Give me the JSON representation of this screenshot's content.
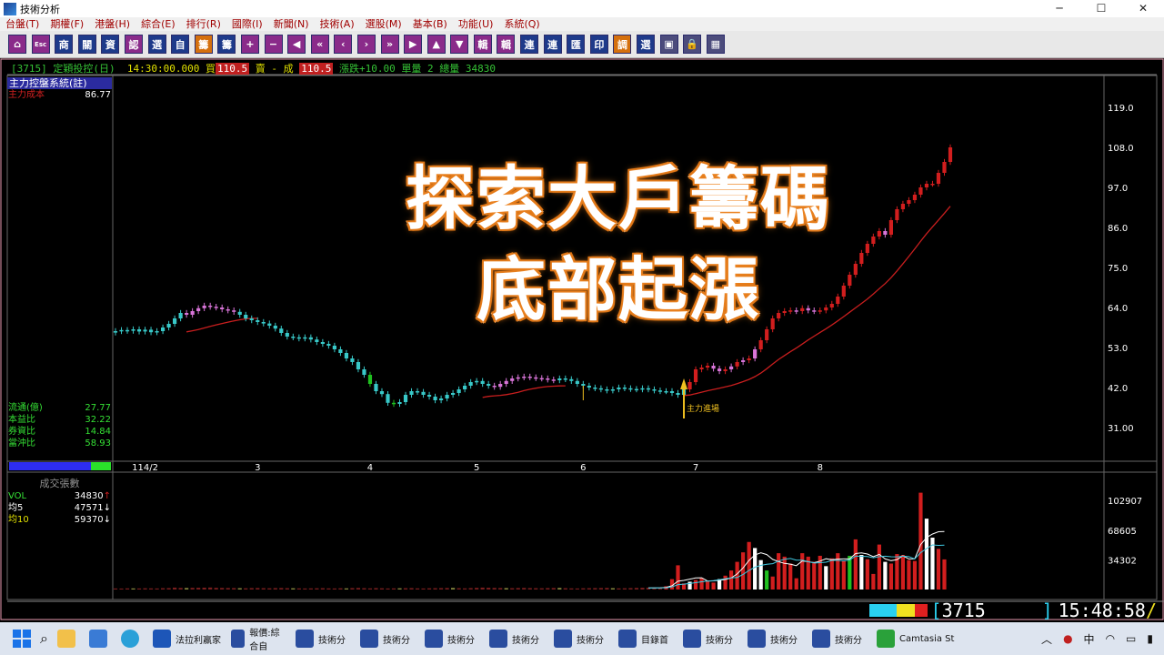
{
  "window": {
    "title": "技術分析",
    "controls": [
      "─",
      "☐",
      "✕"
    ]
  },
  "menu": [
    "台盤(T)",
    "期權(F)",
    "港盤(H)",
    "綜合(E)",
    "排行(R)",
    "國際(I)",
    "新聞(N)",
    "技術(A)",
    "選股(M)",
    "基本(B)",
    "功能(U)",
    "系統(Q)"
  ],
  "toolbar": [
    "⌂",
    "Esc",
    "商",
    "關",
    "資",
    "認",
    "選",
    "自",
    "籌",
    "籌",
    "+",
    "−",
    "◀",
    "«",
    "‹",
    "›",
    "»",
    "▶",
    "▲",
    "▼",
    "輯",
    "輯",
    "連",
    "連",
    "匯",
    "印",
    "調",
    "選",
    "▣",
    "🔒",
    "▦"
  ],
  "status": {
    "code": "[3715]",
    "name": "定穎投控(日)",
    "time": "14:30:00.000",
    "buy_label": "買",
    "buy": "110.5",
    "sell_label": "賣 - 成",
    "deal": "110.5",
    "change_label": "漲跌",
    "change": "+10.00",
    "unit_label": "單量",
    "unit": "2",
    "total_label": "總量",
    "total": "34830"
  },
  "left": {
    "system_name": "主力控盤系統(註)",
    "cost_label": "主力成本",
    "cost_value": "86.77",
    "stats": [
      {
        "label": "流通(億)",
        "value": "27.77"
      },
      {
        "label": "本益比",
        "value": "32.22"
      },
      {
        "label": "券資比",
        "value": "14.84"
      },
      {
        "label": "當沖比",
        "value": "58.93"
      }
    ]
  },
  "volume": {
    "title": "成交張數",
    "rows": [
      {
        "label": "VOL",
        "value": "34830",
        "arrow": "↑"
      },
      {
        "label": "均5",
        "value": "47571",
        "arrow": "↓"
      },
      {
        "label": "均10",
        "value": "59370",
        "arrow": "↓"
      }
    ]
  },
  "overlay": {
    "line1": "探索大戶籌碼",
    "line2": "底部起漲"
  },
  "annotation": "主力進場",
  "ticker": {
    "code": "3715",
    "time": "15:48:58"
  },
  "taskbar": [
    {
      "label": "法拉利嬴家",
      "color": "#1d56b8"
    },
    {
      "label": "報價:綜合自",
      "color": "#2a4d9f"
    },
    {
      "label": "技術分",
      "color": "#2a4d9f"
    },
    {
      "label": "技術分",
      "color": "#2a4d9f"
    },
    {
      "label": "技術分",
      "color": "#2a4d9f"
    },
    {
      "label": "技術分",
      "color": "#2a4d9f"
    },
    {
      "label": "技術分",
      "color": "#2a4d9f"
    },
    {
      "label": "目錄首",
      "color": "#2a4d9f"
    },
    {
      "label": "技術分",
      "color": "#2a4d9f"
    },
    {
      "label": "技術分",
      "color": "#2a4d9f"
    },
    {
      "label": "技術分",
      "color": "#2a4d9f"
    },
    {
      "label": "Camtasia St",
      "color": "#2aa13a"
    }
  ],
  "tray": {
    "ime": "中"
  },
  "chart_data": {
    "type": "candlestick",
    "y_ticks": [
      "119.0",
      "108.0",
      "97.0",
      "86.0",
      "75.0",
      "64.0",
      "53.0",
      "42.0",
      "31.00"
    ],
    "ylim": [
      20,
      130
    ],
    "x_ticks": [
      {
        "label": "114/2",
        "index": 5
      },
      {
        "label": "3",
        "index": 24
      },
      {
        "label": "4",
        "index": 43
      },
      {
        "label": "5",
        "index": 61
      },
      {
        "label": "6",
        "index": 79
      },
      {
        "label": "7",
        "index": 98
      },
      {
        "label": "8",
        "index": 119
      }
    ],
    "closes": [
      57.5,
      57.8,
      57.6,
      58.0,
      57.4,
      57.9,
      57.2,
      57.5,
      58.5,
      59.5,
      61.0,
      62.5,
      62.0,
      63.0,
      63.8,
      64.5,
      64.2,
      64.0,
      63.5,
      63.2,
      62.8,
      62.0,
      61.0,
      60.5,
      60.0,
      59.6,
      59.0,
      58.2,
      57.0,
      56.0,
      55.8,
      55.5,
      55.8,
      55.2,
      54.5,
      54.0,
      53.5,
      52.5,
      51.5,
      50.0,
      49.0,
      47.0,
      45.5,
      43.0,
      41.0,
      40.2,
      37.8,
      37.5,
      38.0,
      40.0,
      41.0,
      40.8,
      40.0,
      39.5,
      38.5,
      39.0,
      40.0,
      40.5,
      41.5,
      42.5,
      43.5,
      43.8,
      43.0,
      42.5,
      42.2,
      43.0,
      43.8,
      44.5,
      44.8,
      45.0,
      44.8,
      44.6,
      44.5,
      44.2,
      44.0,
      44.5,
      44.3,
      43.8,
      43.0,
      42.5,
      42.0,
      41.8,
      41.5,
      41.2,
      41.5,
      42.0,
      41.8,
      41.6,
      41.5,
      41.8,
      41.5,
      41.2,
      41.0,
      41.0,
      40.5,
      40.0,
      41.5,
      43.5,
      47.0,
      47.5,
      48.0,
      47.2,
      46.5,
      47.0,
      47.8,
      49.0,
      49.5,
      50.0,
      52.5,
      55.0,
      58.0,
      61.0,
      62.5,
      63.0,
      63.2,
      63.0,
      63.8,
      63.2,
      63.0,
      63.2,
      64.0,
      65.0,
      67.0,
      70.0,
      73.0,
      76.0,
      79.0,
      81.5,
      83.5,
      85.0,
      84.0,
      88.0,
      91.0,
      92.5,
      93.5,
      95.0,
      97.0,
      98.0,
      98.0,
      101.0,
      104.0,
      108.0
    ],
    "kline_colors": {
      "up": "#d21e1e",
      "down": "#38c8c8",
      "accum": "#d874d8",
      "signal": "#20c020"
    },
    "volumes": [
      1200,
      1100,
      1300,
      1250,
      1200,
      1400,
      1300,
      1200,
      1500,
      1600,
      2200,
      1800,
      1700,
      1900,
      2000,
      2100,
      2300,
      1900,
      1800,
      1700,
      1600,
      1500,
      1400,
      1600,
      1700,
      1500,
      1400,
      1600,
      1700,
      1500,
      1400,
      1300,
      1200,
      1300,
      1400,
      1500,
      1300,
      1200,
      1400,
      1300,
      1600,
      1800,
      1500,
      1300,
      1600,
      1400,
      1200,
      1300,
      1400,
      1500,
      1600,
      1300,
      1200,
      1400,
      1500,
      1600,
      1700,
      1800,
      1500,
      1300,
      1600,
      1900,
      2200,
      2000,
      1800,
      1700,
      1600,
      1500,
      1700,
      1800,
      1600,
      1500,
      1400,
      1600,
      1700,
      1800,
      1500,
      1300,
      1200,
      1400,
      1500,
      1600,
      1700,
      1800,
      1500,
      1300,
      1400,
      1600,
      1800,
      2000,
      2200,
      2100,
      1900,
      3800,
      12000,
      28000,
      7000,
      9000,
      11000,
      13000,
      9000,
      8000,
      12000,
      16000,
      22000,
      32000,
      43000,
      55000,
      48000,
      34000,
      22000,
      15000,
      42000,
      38000,
      30000,
      13000,
      42000,
      38000,
      32000,
      39000,
      27000,
      36000,
      42000,
      33000,
      39000,
      58000,
      40000,
      35000,
      18000,
      52000,
      32000,
      30000,
      41000,
      40000,
      34000,
      33000,
      112000,
      82000,
      60000,
      47000,
      34830
    ],
    "volume_ticks": [
      "102907",
      "68605",
      "34302"
    ],
    "volume_lim": [
      0,
      120000
    ],
    "ma_label": "主力成本"
  }
}
